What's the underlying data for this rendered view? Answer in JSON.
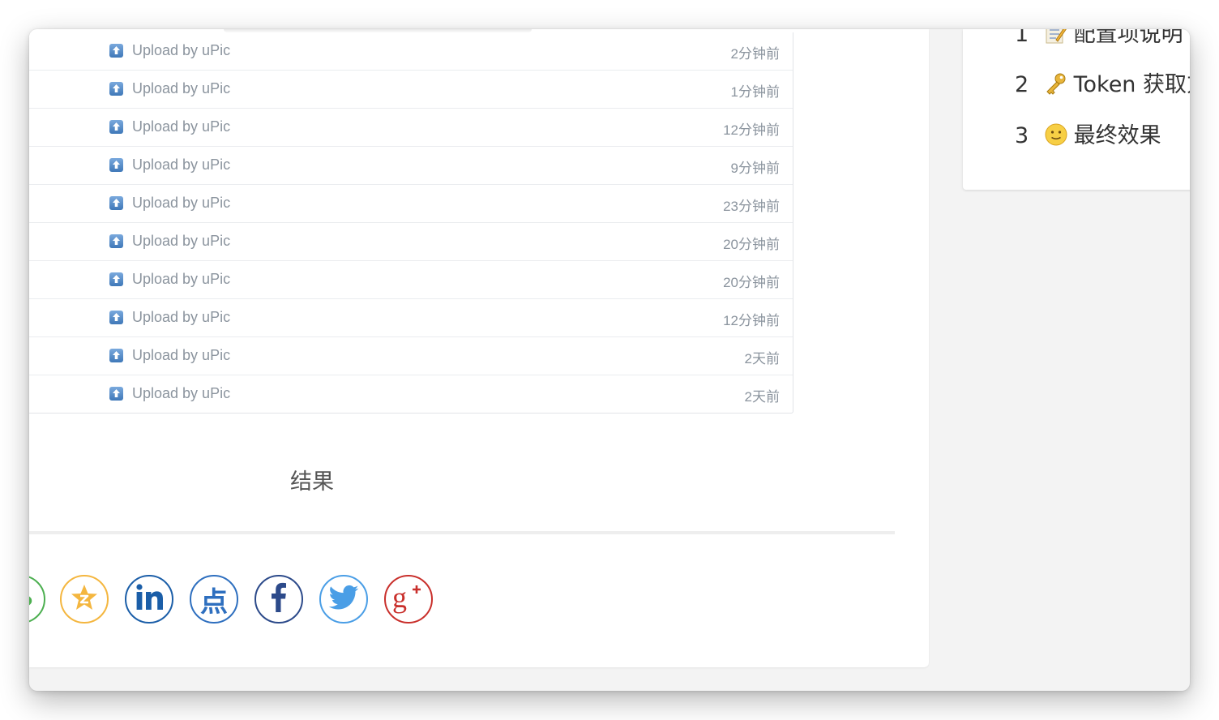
{
  "commits": [
    {
      "message": "Upload by uPic",
      "time": "2分钟前"
    },
    {
      "message": "Upload by uPic",
      "time": "1分钟前"
    },
    {
      "message": "Upload by uPic",
      "time": "12分钟前"
    },
    {
      "message": "Upload by uPic",
      "time": "9分钟前"
    },
    {
      "message": "Upload by uPic",
      "time": "23分钟前"
    },
    {
      "message": "Upload by uPic",
      "time": "20分钟前"
    },
    {
      "message": "Upload by uPic",
      "time": "20分钟前"
    },
    {
      "message": "Upload by uPic",
      "time": "12分钟前"
    },
    {
      "message": "Upload by uPic",
      "time": "2天前"
    },
    {
      "message": "Upload by uPic",
      "time": "2天前"
    }
  ],
  "caption": "结果",
  "share": [
    {
      "name": "wechat",
      "icon": "wechat-icon",
      "color": "#4caf50"
    },
    {
      "name": "qzone",
      "icon": "qzone-star-icon",
      "color": "#f4b63f"
    },
    {
      "name": "linkedin",
      "icon": "linkedin-icon",
      "color": "#1b5ea8"
    },
    {
      "name": "diandian",
      "icon": "diandian-icon",
      "color": "#2e6fbf",
      "glyph": "点"
    },
    {
      "name": "facebook",
      "icon": "facebook-icon",
      "color": "#2c4a8a"
    },
    {
      "name": "twitter",
      "icon": "twitter-bird-icon",
      "color": "#4a9ee6"
    },
    {
      "name": "google-plus",
      "icon": "google-plus-icon",
      "color": "#c9302c"
    }
  ],
  "toc": [
    {
      "num": "1",
      "icon": "memo-icon",
      "label": "配置项说明"
    },
    {
      "num": "2",
      "icon": "key-icon",
      "label": "Token 获取方"
    },
    {
      "num": "3",
      "icon": "smile-icon",
      "label": "最终效果"
    }
  ]
}
